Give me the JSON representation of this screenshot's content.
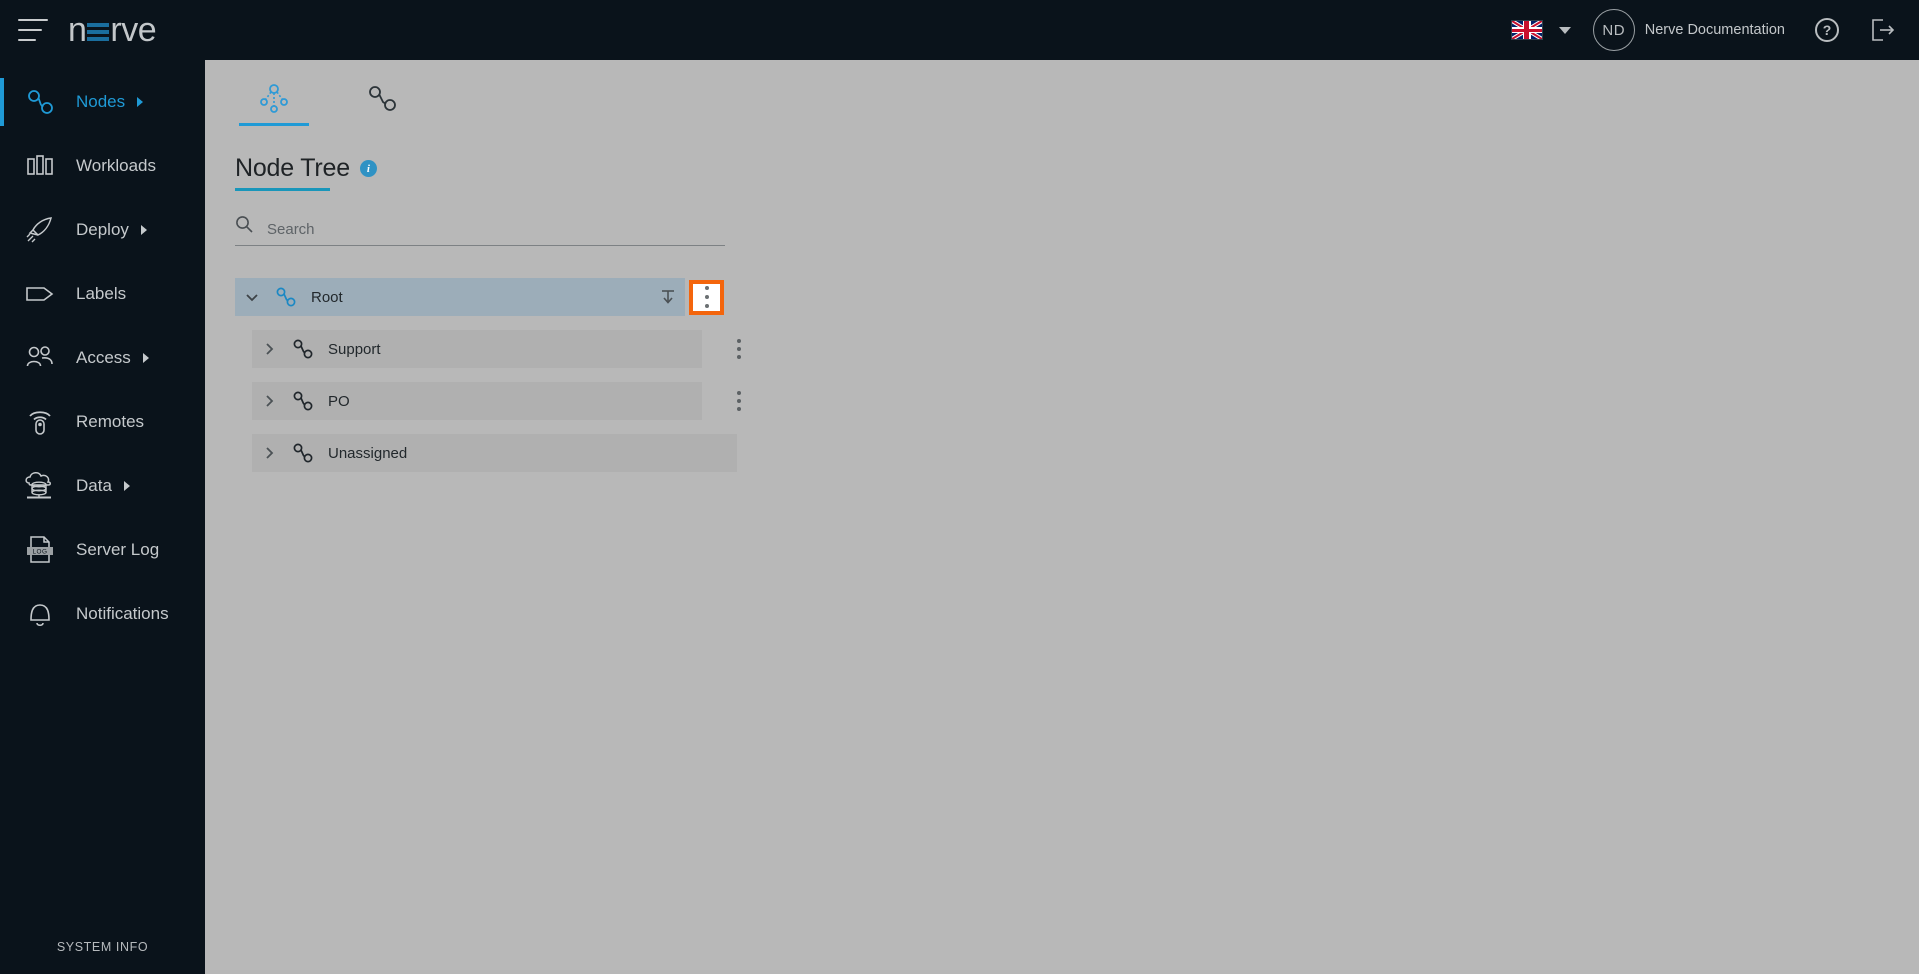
{
  "topbar": {
    "menu_icon": "hamburger-icon",
    "logo_part1": "n",
    "logo_part2": "rve",
    "language_flag": "uk-flag-icon",
    "language_caret": "chevron-down-icon",
    "avatar_initials": "ND",
    "user_name": "Nerve Documentation",
    "help_label": "?",
    "help_icon": "help-icon",
    "logout_icon": "logout-icon"
  },
  "sidebar": {
    "items": [
      {
        "label": "Nodes",
        "icon": "node-tree-icon",
        "active": true,
        "has_caret": true
      },
      {
        "label": "Workloads",
        "icon": "bar-chart-icon",
        "active": false,
        "has_caret": false
      },
      {
        "label": "Deploy",
        "icon": "rocket-icon",
        "active": false,
        "has_caret": true
      },
      {
        "label": "Labels",
        "icon": "tag-icon",
        "active": false,
        "has_caret": false
      },
      {
        "label": "Access",
        "icon": "users-icon",
        "active": false,
        "has_caret": true
      },
      {
        "label": "Remotes",
        "icon": "remote-icon",
        "active": false,
        "has_caret": false
      },
      {
        "label": "Data",
        "icon": "cloud-data-icon",
        "active": false,
        "has_caret": true
      },
      {
        "label": "Server Log",
        "icon": "log-file-icon",
        "active": false,
        "has_caret": false
      },
      {
        "label": "Notifications",
        "icon": "bell-icon",
        "active": false,
        "has_caret": false
      }
    ],
    "footer_label": "SYSTEM INFO"
  },
  "main": {
    "tabs": [
      {
        "name": "node-tree-tab",
        "icon": "hierarchy-tree-icon",
        "active": true
      },
      {
        "name": "node-list-tab",
        "icon": "node-link-icon",
        "active": false
      }
    ],
    "page_title": "Node Tree",
    "info_glyph": "i",
    "search": {
      "placeholder": "Search",
      "value": "",
      "icon": "search-icon"
    },
    "tree": {
      "rows": [
        {
          "label": "Root",
          "level": 0,
          "expanded": true,
          "chevron": "chevron-down-icon",
          "icon": "node-tree-icon-blue",
          "has_import": true,
          "import_icon": "import-download-icon",
          "has_kebab": true,
          "kebab_highlighted": true
        },
        {
          "label": "Support",
          "level": 1,
          "expanded": false,
          "chevron": "chevron-right-icon",
          "icon": "node-tree-icon-dark",
          "has_import": false,
          "has_kebab": true,
          "kebab_highlighted": false
        },
        {
          "label": "PO",
          "level": 1,
          "expanded": false,
          "chevron": "chevron-right-icon",
          "icon": "node-tree-icon-dark",
          "has_import": false,
          "has_kebab": true,
          "kebab_highlighted": false
        },
        {
          "label": "Unassigned",
          "level": 1,
          "expanded": false,
          "chevron": "chevron-right-icon",
          "icon": "node-tree-icon-dark",
          "has_import": false,
          "has_kebab": false,
          "kebab_highlighted": false
        }
      ]
    }
  },
  "colors": {
    "accent_blue": "#1f9ad6",
    "title_underline": "#1996ba",
    "highlight_orange": "#f4650c",
    "sidebar_bg": "#0a131b",
    "page_bg": "#b8b8b8",
    "row_selected": "#9cadb9",
    "row_child": "#b0b0b0",
    "info_badge": "#2f92c4"
  }
}
